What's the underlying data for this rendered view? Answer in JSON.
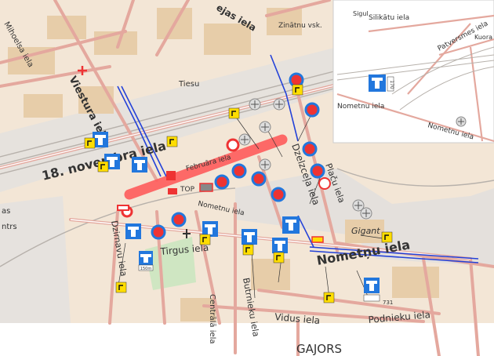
{
  "map": {
    "streets": {
      "viestura": "Viestura iela",
      "november": "18. novembra iela",
      "mihoelsa": "Mihoelsa iela",
      "tiesu": "Tiesu",
      "zinatnu": "Zinātnu vsk.",
      "rejas": "ejas iela",
      "februara": "Februāra iela",
      "nometnu_top": "Nometnu iela",
      "dzelzcela": "Dzelzceļa iela",
      "placu": "Plaču iela",
      "dzirnavu": "Dzirnavu iela",
      "tirgus": "Tirgus iela",
      "nometnu_main": "Nometņu iela",
      "butrnieku": "Butrnieku iela",
      "vidus": "Vidus iela",
      "podnieku": "Podnieku iela",
      "gajorisa": "GAJORS",
      "gigant": "Gigant",
      "tirgus_place": "Tirgus",
      "as": "as",
      "ntrs": "ntrs",
      "centrala": "Centrālā iela"
    },
    "inset": {
      "silikatu": "Silikātu iela",
      "patversmes": "Patversmes iela",
      "nometnu_1": "Nometnu iela",
      "nometnu_2": "Nometnu iela",
      "sigu": "Sigul",
      "kuora": "Kuora",
      "sign_num": "170"
    },
    "labels": {
      "top_sign": "TOP",
      "sign_150": "150m",
      "sign_731": "731"
    },
    "colors": {
      "background": "#f3e6d6",
      "road": "#e4a89e",
      "closure": "#ff5c5c",
      "route": "#2442d8",
      "sign_blue": "#2277dd",
      "sign_yellow": "#ffdd00"
    }
  }
}
